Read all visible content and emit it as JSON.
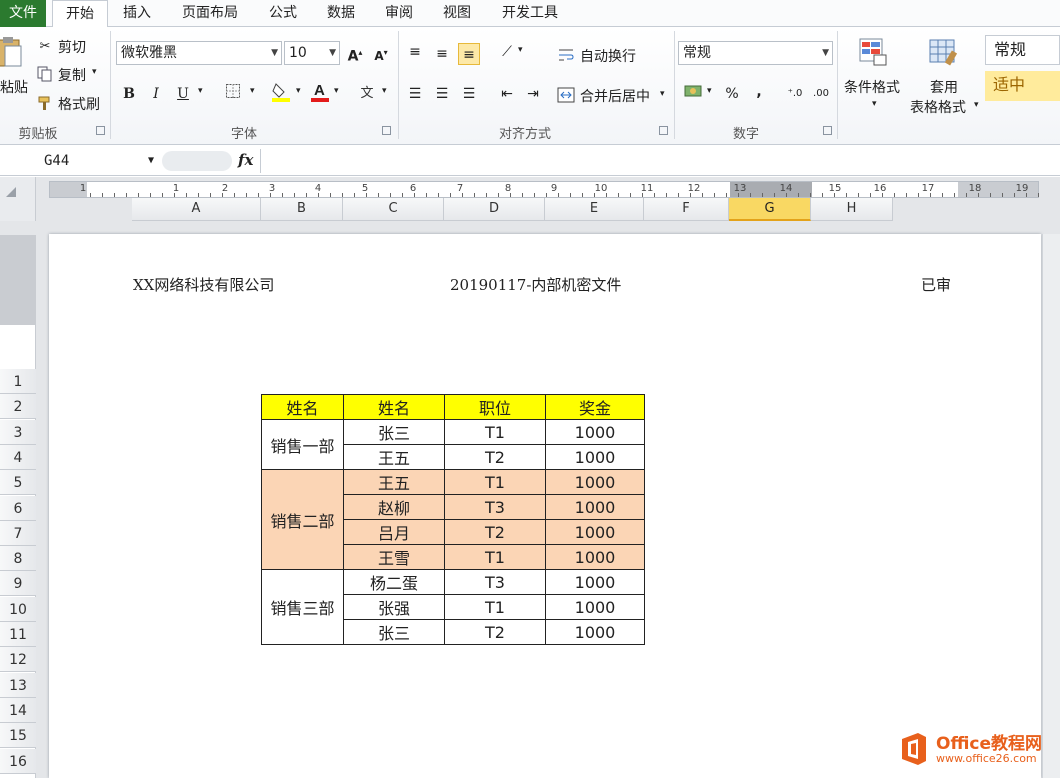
{
  "tabs": [
    "文件",
    "开始",
    "插入",
    "页面布局",
    "公式",
    "数据",
    "审阅",
    "视图",
    "开发工具"
  ],
  "active_tab": "开始",
  "ribbon": {
    "clipboard": {
      "paste_label": "粘贴",
      "cut_label": "剪切",
      "copy_label": "复制",
      "format_painter_label": "格式刷",
      "group_label": "剪贴板"
    },
    "font": {
      "font_name": "微软雅黑",
      "font_size": "10",
      "group_label": "字体",
      "bold": "B",
      "italic": "I",
      "underline": "U"
    },
    "alignment": {
      "wrap_text_label": "自动换行",
      "merge_center_label": "合并后居中",
      "group_label": "对齐方式"
    },
    "number": {
      "format_value": "常规",
      "percent": "%",
      "comma": ",",
      "group_label": "数字"
    },
    "styles": {
      "conditional_format_label": "条件格式",
      "table_format_label_1": "套用",
      "table_format_label_2": "表格格式",
      "style_normal": "常规",
      "style_neutral": "适中"
    }
  },
  "formula_bar": {
    "name_box": "G44",
    "fx": "fx",
    "formula": ""
  },
  "ruler_numbers": [
    "1",
    "1",
    "2",
    "3",
    "4",
    "5",
    "6",
    "7",
    "8",
    "9",
    "10",
    "11",
    "12",
    "13",
    "14",
    "15",
    "16",
    "17",
    "18",
    "19"
  ],
  "columns": [
    "A",
    "B",
    "C",
    "D",
    "E",
    "F",
    "G",
    "H"
  ],
  "selected_column": "G",
  "rows": [
    "1",
    "2",
    "3",
    "4",
    "5",
    "6",
    "7",
    "8",
    "9",
    "10",
    "11",
    "12",
    "13",
    "14",
    "15",
    "16"
  ],
  "page_header": {
    "left": "XX网络科技有限公司",
    "center": "20190117-内部机密文件",
    "right": "已审"
  },
  "table": {
    "headers": [
      "姓名",
      "姓名",
      "职位",
      "奖金"
    ],
    "groups": [
      {
        "dept": "销售一部",
        "rows": [
          [
            "张三",
            "T1",
            "1000"
          ],
          [
            "王五",
            "T2",
            "1000"
          ]
        ]
      },
      {
        "dept": "销售二部",
        "rows": [
          [
            "王五",
            "T1",
            "1000"
          ],
          [
            "赵柳",
            "T3",
            "1000"
          ],
          [
            "吕月",
            "T2",
            "1000"
          ],
          [
            "王雪",
            "T1",
            "1000"
          ]
        ]
      },
      {
        "dept": "销售三部",
        "rows": [
          [
            "杨二蛋",
            "T3",
            "1000"
          ],
          [
            "张强",
            "T1",
            "1000"
          ],
          [
            "张三",
            "T2",
            "1000"
          ]
        ]
      }
    ]
  },
  "watermark": {
    "brand": "Office教程网",
    "url": "www.office26.com"
  },
  "colors": {
    "file_tab": "#2b7a2f",
    "header_fill": "#ffff00",
    "group2_fill": "#fbd5b5",
    "selected_col": "#f9d863",
    "watermark": "#e8601c"
  }
}
